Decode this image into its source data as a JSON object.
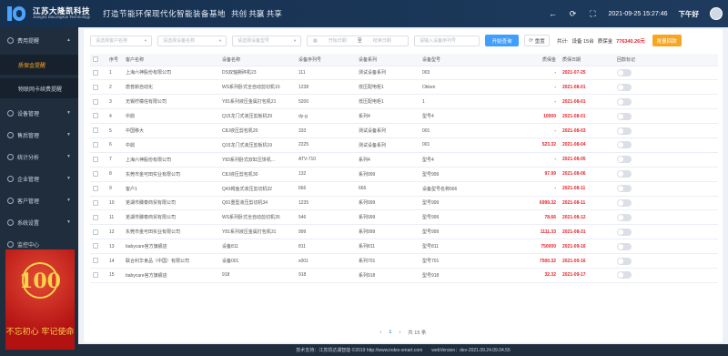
{
  "header": {
    "brand_cn": "江苏大隆凯科技",
    "brand_en": "Jiangsu DaLongKai Technology",
    "slogan": "打造节能环保现代化智能装备基地",
    "slogan2": "共创 共赢 共享",
    "datetime": "2021-09-25 15:27:46",
    "greeting": "下午好"
  },
  "sidebar": {
    "items": [
      {
        "label": "费用提醒"
      },
      {
        "label": "质保金提醒"
      },
      {
        "label": "物联网卡续费提醒"
      },
      {
        "label": "设备管理"
      },
      {
        "label": "售后管理"
      },
      {
        "label": "统计分析"
      },
      {
        "label": "企业管理"
      },
      {
        "label": "客户管理"
      },
      {
        "label": "系统设置"
      },
      {
        "label": "监控中心"
      }
    ],
    "poster_number": "100",
    "poster_caption": "不忘初心 牢记使命"
  },
  "filters": {
    "customer_placeholder": "请选择客户名称",
    "device_name_placeholder": "请选择设备名称",
    "device_model_placeholder": "请选择设备型号",
    "start_date_placeholder": "开始日期",
    "date_sep": "至",
    "end_date_placeholder": "结束日期",
    "serial_placeholder": "请输入设备序列号",
    "search_label": "开始查询",
    "reset_label": "重置"
  },
  "stats": {
    "total_label": "共计:",
    "device_count": "设备 15台",
    "deposit_label": "质保金",
    "deposit_value": "776340.26元",
    "batch_label": "批量回款"
  },
  "table": {
    "headers": [
      "序号",
      "客户名称",
      "设备名称",
      "设备序列号",
      "设备系列",
      "设备型号",
      "质保金",
      "质保日期",
      "回款标记"
    ],
    "rows": [
      {
        "no": "1",
        "customer": "上海六神股份有限公司",
        "device": "DS双轴撕碎机23",
        "serial": "111",
        "series": "测试设备系列",
        "model": "003",
        "deposit": "-",
        "date": "2021-07-25"
      },
      {
        "no": "2",
        "customer": "唐普斯自动化",
        "device": "WS系列卧式全自动剪切机15",
        "serial": "1238",
        "series": "低压配电柜1",
        "model": "Okken",
        "deposit": "-",
        "date": "2021-08-01"
      },
      {
        "no": "3",
        "customer": "无锡柠檬信有限公司",
        "device": "Y81系列液压金属打包机21",
        "serial": "5200",
        "series": "低压配电柜1",
        "model": "1",
        "deposit": "-",
        "date": "2021-08-01"
      },
      {
        "no": "4",
        "customer": "中鼎",
        "device": "Q15龙门式液压剪板机29",
        "serial": "dy-g",
        "series": "系列4",
        "model": "型号4",
        "deposit": "10000",
        "date": "2021-08-01"
      },
      {
        "no": "5",
        "customer": "中国移大",
        "device": "C8J液压剪包机20",
        "serial": "333",
        "series": "测试设备系列",
        "model": "001",
        "deposit": "-",
        "date": "2021-08-03"
      },
      {
        "no": "6",
        "customer": "中鼎",
        "device": "Q15龙门式液压剪板机19",
        "serial": "2225",
        "series": "测试设备系列",
        "model": "001",
        "deposit": "523.32",
        "date": "2021-08-04"
      },
      {
        "no": "7",
        "customer": "上海六神股份有限公司",
        "device": "Y83系列卧式双缸压饼机...",
        "serial": "ATV-710",
        "series": "系列4",
        "model": "型号4",
        "deposit": "-",
        "date": "2021-08-05"
      },
      {
        "no": "8",
        "customer": "东莞市金可田实业有限公司",
        "device": "C8J液压剪包机30",
        "serial": "132",
        "series": "系列999",
        "model": "型号999",
        "deposit": "97.99",
        "date": "2021-08-06"
      },
      {
        "no": "9",
        "customer": "客户1",
        "device": "Q43鳄鱼式液压剪切机32",
        "serial": "666",
        "series": "666",
        "model": "设备型号名称666",
        "deposit": "-",
        "date": "2021-08-11"
      },
      {
        "no": "10",
        "customer": "芜湖市滕泰商贸有限公司",
        "device": "Q91重型液压剪切机34",
        "serial": "1235",
        "series": "系列999",
        "model": "型号999",
        "deposit": "6999.32",
        "date": "2021-08-11"
      },
      {
        "no": "11",
        "customer": "芜湖市滕泰商贸有限公司",
        "device": "WS系列卧式全自动剪切机35",
        "serial": "546",
        "series": "系列999",
        "model": "型号999",
        "deposit": "78.66",
        "date": "2021-08-12"
      },
      {
        "no": "12",
        "customer": "东莞市金可田实业有限公司",
        "device": "Y81系列液压金属打包机31",
        "serial": "999",
        "series": "系列999",
        "model": "型号999",
        "deposit": "1111.33",
        "date": "2021-08-31"
      },
      {
        "no": "13",
        "customer": "babycare官方旗舰店",
        "device": "设备811",
        "serial": "811",
        "series": "系列811",
        "model": "型号811",
        "deposit": "750000",
        "date": "2021-09-16"
      },
      {
        "no": "14",
        "customer": "联合利华食品（中国）有限公司",
        "device": "设备001",
        "serial": "x001",
        "series": "系列701",
        "model": "型号701",
        "deposit": "7500.32",
        "date": "2021-09-16"
      },
      {
        "no": "15",
        "customer": "babycare官方旗舰店",
        "device": "918",
        "serial": "918",
        "series": "系列918",
        "model": "型号918",
        "deposit": "32.32",
        "date": "2021-09-17"
      }
    ]
  },
  "pager": {
    "prev": "‹",
    "current": "1",
    "next": "›",
    "total": "共 15 条"
  },
  "footer": {
    "support": "技术支持：江苏凯达湖智能 ©2019 http://www.index-smart.com",
    "version": "webVersion：dev-2021.09.24.09.04.55"
  }
}
